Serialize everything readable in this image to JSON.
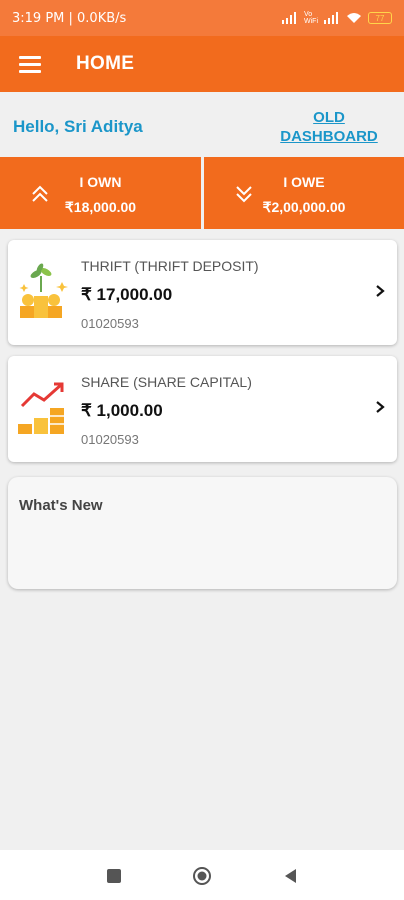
{
  "status_bar": {
    "time": "3:19 PM | 0.0KB/s",
    "network_label": "Vo WiFi",
    "battery": "77"
  },
  "app_bar": {
    "title": "HOME"
  },
  "greeting": "Hello, Sri Aditya",
  "old_dashboard": {
    "line1": "OLD",
    "line2": "DASHBOARD"
  },
  "summary": {
    "own": {
      "label": "I OWN",
      "value": "₹18,000.00"
    },
    "owe": {
      "label": "I OWE",
      "value": "₹2,00,000.00"
    }
  },
  "accounts": [
    {
      "title": "THRIFT  (THRIFT DEPOSIT)",
      "amount": "₹ 17,000.00",
      "account_no": "01020593",
      "icon": "plant-coins-icon"
    },
    {
      "title": "SHARE  (SHARE CAPITAL)",
      "amount": "₹ 1,000.00",
      "account_no": "01020593",
      "icon": "growth-chart-coins-icon"
    }
  ],
  "whats_new": {
    "title": "What's New"
  },
  "colors": {
    "primary": "#f26b1d",
    "status_bar": "#f47a3a",
    "link": "#1b96c9",
    "background": "#f0f0f0"
  }
}
